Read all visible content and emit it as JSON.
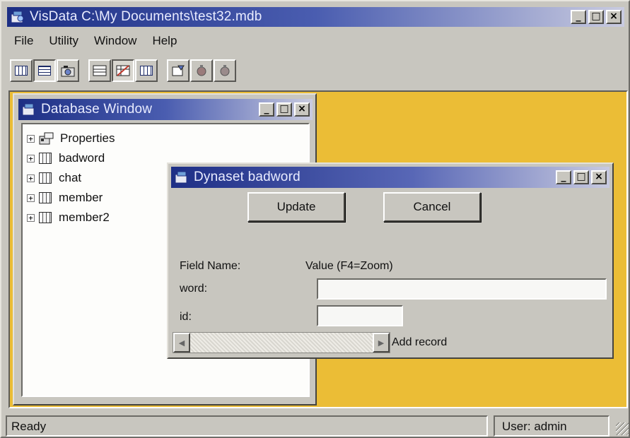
{
  "app": {
    "title": "VisData C:\\My Documents\\test32.mdb",
    "window_controls": [
      "_",
      "□",
      "×"
    ]
  },
  "menu": {
    "items": [
      "File",
      "Utility",
      "Window",
      "Help"
    ]
  },
  "toolbar": {
    "buttons": [
      "table-icon",
      "dynaset-icon",
      "snapshot-icon",
      "data-control-icon",
      "dbgrid-icon",
      "grid-icon",
      "sql-icon",
      "commit-icon",
      "rollback-icon"
    ]
  },
  "db_window": {
    "title": "Database Window",
    "tree": [
      {
        "label": "Properties"
      },
      {
        "label": "badword"
      },
      {
        "label": "chat"
      },
      {
        "label": "member"
      },
      {
        "label": "member2"
      }
    ]
  },
  "dynaset": {
    "title": "Dynaset badword",
    "update_label": "Update",
    "cancel_label": "Cancel",
    "field_name_header": "Field Name:",
    "value_header": "Value (F4=Zoom)",
    "fields": [
      {
        "name": "word:",
        "value": ""
      },
      {
        "name": "id:",
        "value": ""
      }
    ],
    "add_record_label": "Add record"
  },
  "status": {
    "left": "Ready",
    "right": "User: admin"
  }
}
